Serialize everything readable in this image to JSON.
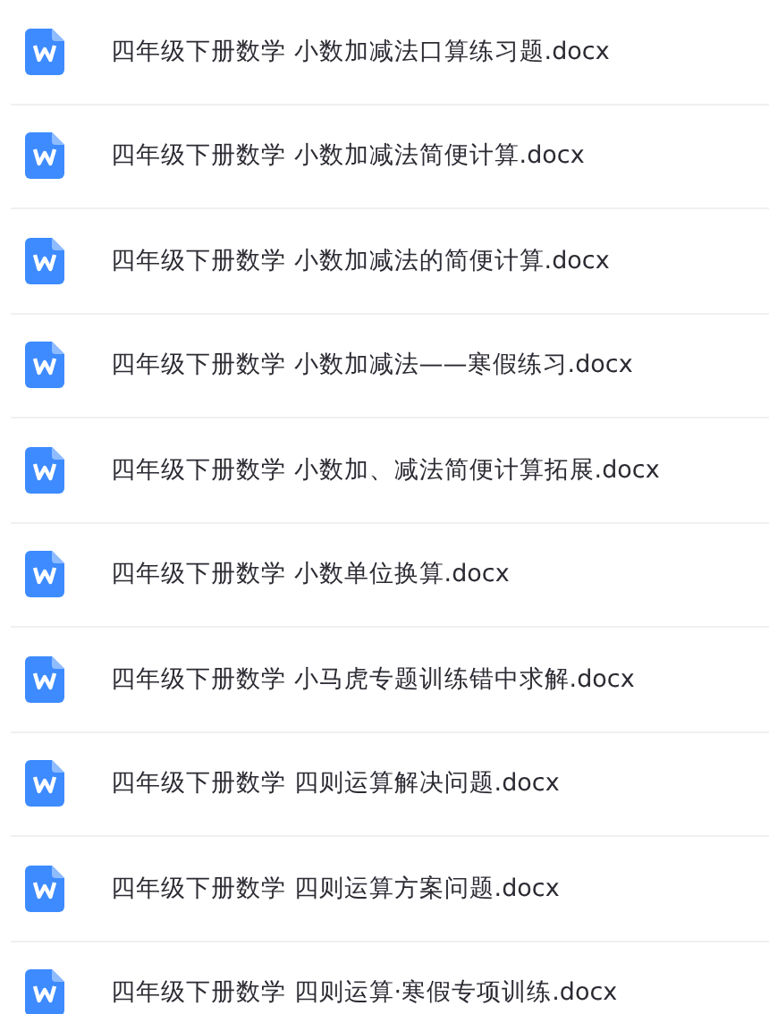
{
  "files": [
    {
      "name": "四年级下册数学 小数加减法口算练习题.docx",
      "kind": "word"
    },
    {
      "name": "四年级下册数学 小数加减法简便计算.docx",
      "kind": "word"
    },
    {
      "name": "四年级下册数学 小数加减法的简便计算.docx",
      "kind": "word"
    },
    {
      "name": "四年级下册数学 小数加减法——寒假练习.docx",
      "kind": "word"
    },
    {
      "name": "四年级下册数学 小数加、减法简便计算拓展.docx",
      "kind": "word"
    },
    {
      "name": "四年级下册数学 小数单位换算.docx",
      "kind": "word"
    },
    {
      "name": "四年级下册数学 小马虎专题训练错中求解.docx",
      "kind": "word"
    },
    {
      "name": "四年级下册数学 四则运算解决问题.docx",
      "kind": "word"
    },
    {
      "name": "四年级下册数学 四则运算方案问题.docx",
      "kind": "word"
    },
    {
      "name": "四年级下册数学 四则运算·寒假专项训练.docx",
      "kind": "word"
    }
  ]
}
